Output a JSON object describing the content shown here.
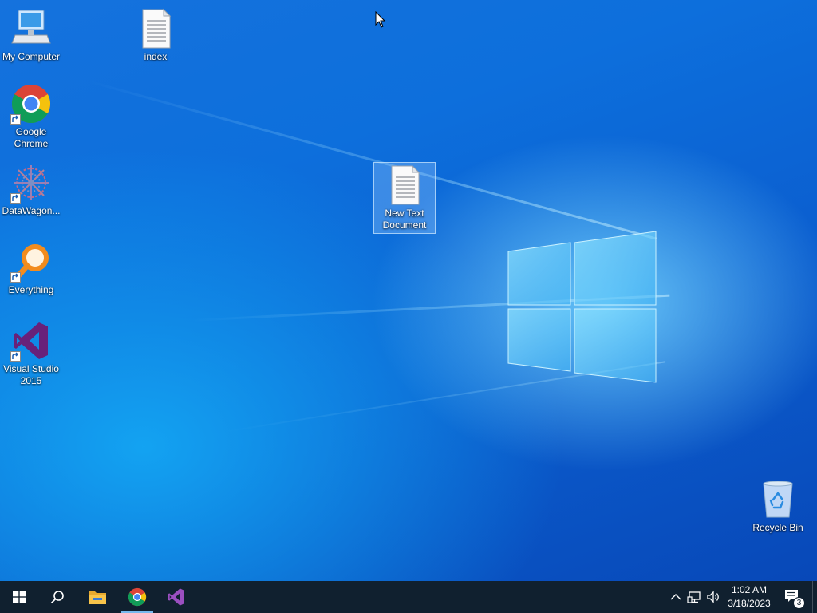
{
  "desktop": {
    "icons": [
      {
        "label": "My Computer",
        "icon": "computer-icon"
      },
      {
        "label": "index",
        "icon": "text-file-icon"
      },
      {
        "label": "Google Chrome",
        "icon": "chrome-icon",
        "shortcut": true
      },
      {
        "label": "DataWagon...",
        "icon": "datawagon-icon",
        "shortcut": true
      },
      {
        "label": "Everything",
        "icon": "everything-search-icon",
        "shortcut": true
      },
      {
        "label": "Visual Studio 2015",
        "icon": "visual-studio-icon",
        "shortcut": true
      },
      {
        "label": "New Text Document",
        "icon": "text-file-icon",
        "selected": true
      },
      {
        "label": "Recycle Bin",
        "icon": "recycle-bin-icon"
      }
    ]
  },
  "taskbar": {
    "start": "windows-start-icon",
    "search": "search-icon",
    "pinned": [
      {
        "name": "File Explorer",
        "icon": "folder-icon"
      },
      {
        "name": "Google Chrome",
        "icon": "chrome-icon",
        "active": true
      },
      {
        "name": "Visual Studio",
        "icon": "visual-studio-icon"
      }
    ],
    "tray": {
      "chevron": "chevron-up-icon",
      "network": "network-icon",
      "volume": "volume-icon"
    },
    "clock": {
      "time": "1:02 AM",
      "date": "3/18/2023"
    },
    "notifications": {
      "icon": "action-center-icon",
      "count": "3"
    }
  },
  "colors": {
    "taskbar_bg": "#10202f",
    "desktop_blue": "#0b5fd0",
    "chrome_red": "#db4437",
    "chrome_yellow": "#f4c20d",
    "chrome_green": "#0f9d58",
    "chrome_blue": "#4285f4",
    "vs_purple": "#68217a",
    "everything_orange": "#f28c1e"
  }
}
